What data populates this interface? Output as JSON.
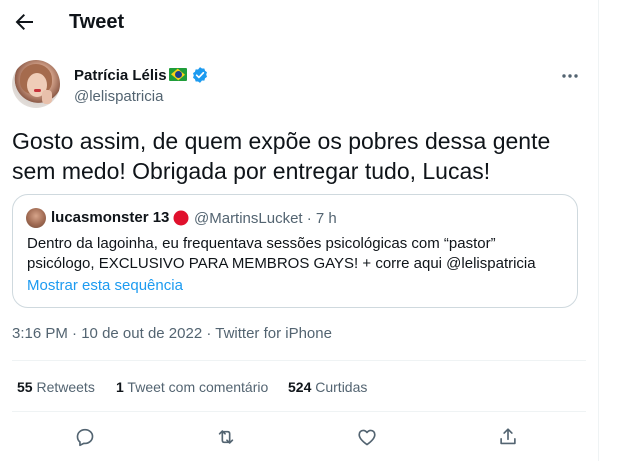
{
  "header": {
    "title": "Tweet"
  },
  "author": {
    "name": "Patrícia Lélis",
    "handle": "@lelispatricia"
  },
  "tweet": {
    "text": "Gosto assim, de quem expõe os pobres dessa gente sem medo! Obrigada por entregar tudo, Lucas!"
  },
  "quote": {
    "name": "lucasmonster 13",
    "handle_time": "@MartinsLucket · 7 h",
    "text": "Dentro da lagoinha, eu frequentava sessões psicológicas com “pastor” psicólogo, EXCLUSIVO PARA MEMBROS GAYS! + corre aqui @lelispatricia",
    "show_thread": "Mostrar esta sequência"
  },
  "meta": {
    "time": "3:16 PM",
    "sep1": " · ",
    "date": "10 de out de 2022",
    "sep2": " · ",
    "source": "Twitter for iPhone"
  },
  "stats": {
    "retweets_count": "55",
    "retweets_label": " Retweets",
    "quotes_count": "1",
    "quotes_label": " Tweet com comentário",
    "likes_count": "524",
    "likes_label": " Curtidas"
  },
  "icons": {
    "back": "arrow-left-icon",
    "more": "ellipsis-icon",
    "verified": "verified-badge-icon",
    "flag": "brazil-flag-icon",
    "quote_badge": "red-circle-icon",
    "reply": "reply-icon",
    "retweet": "retweet-icon",
    "like": "heart-icon",
    "share": "share-icon"
  },
  "colors": {
    "accent": "#1d9bf0",
    "text": "#0f1419",
    "secondary": "#536471",
    "border": "#cfd9de",
    "badge": "#e0102c"
  }
}
